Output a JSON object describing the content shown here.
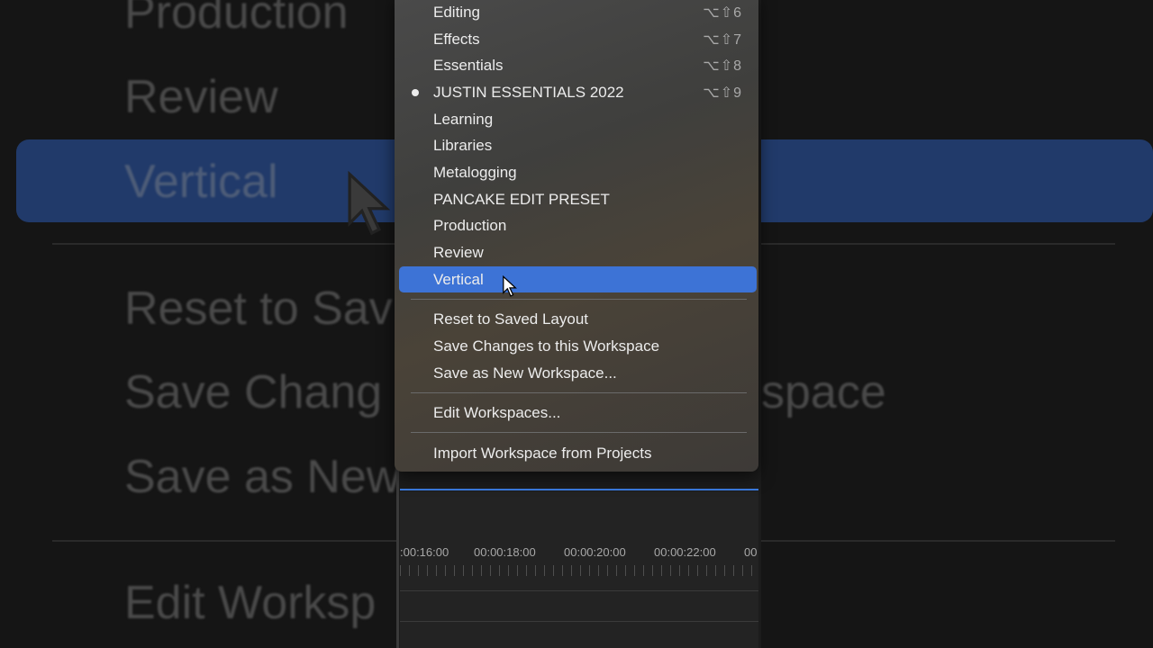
{
  "background": {
    "items": [
      {
        "text": "Production"
      },
      {
        "text": "Review"
      },
      {
        "text": "Vertical"
      },
      {
        "text": "Reset to Sav"
      },
      {
        "text": "Save Chang"
      },
      {
        "text": "Save as New"
      },
      {
        "text": "Edit Worksp"
      }
    ],
    "right_fragment": "space"
  },
  "menu": {
    "items": [
      {
        "label": "Editing",
        "shortcut": "⌥⇧6"
      },
      {
        "label": "Effects",
        "shortcut": "⌥⇧7"
      },
      {
        "label": "Essentials",
        "shortcut": "⌥⇧8"
      },
      {
        "label": "JUSTIN ESSENTIALS 2022",
        "shortcut": "⌥⇧9",
        "checked": true
      },
      {
        "label": "Learning"
      },
      {
        "label": "Libraries"
      },
      {
        "label": "Metalogging"
      },
      {
        "label": "PANCAKE EDIT PRESET"
      },
      {
        "label": "Production"
      },
      {
        "label": "Review"
      },
      {
        "label": "Vertical",
        "highlighted": true
      }
    ],
    "actions": [
      {
        "label": "Reset to Saved Layout"
      },
      {
        "label": "Save Changes to this Workspace"
      },
      {
        "label": "Save as New Workspace..."
      },
      {
        "label": "Edit Workspaces..."
      },
      {
        "label": "Import Workspace from Projects"
      }
    ]
  },
  "timeline": {
    "timecodes": [
      ":00:16:00",
      "00:00:18:00",
      "00:00:20:00",
      "00:00:22:00",
      "00"
    ]
  },
  "colors": {
    "accent": "#3d73d6",
    "playhead_line": "#3b7be0"
  }
}
